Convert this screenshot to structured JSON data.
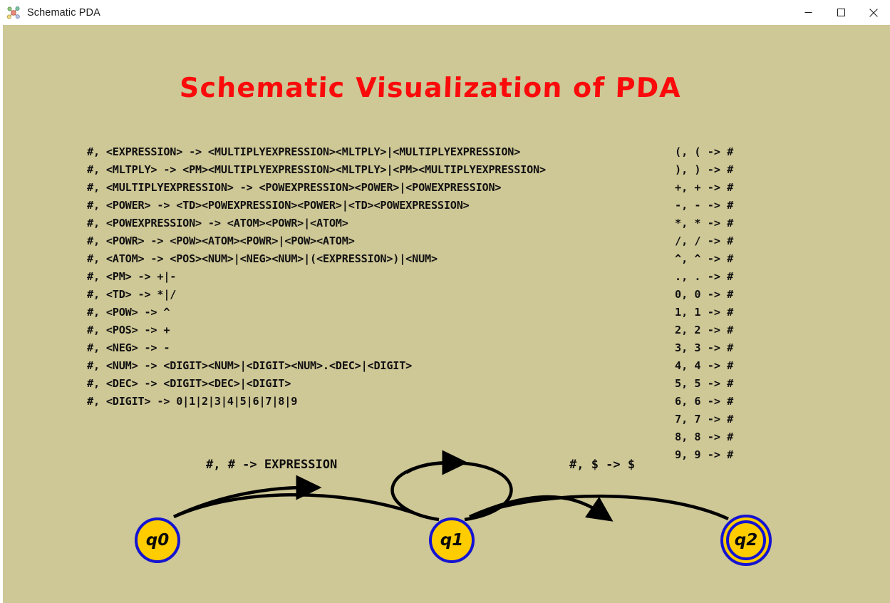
{
  "window": {
    "title": "Schematic PDA",
    "icon": "graph-nodes-icon",
    "minimize_label": "Minimize",
    "maximize_label": "Maximize",
    "close_label": "Close"
  },
  "colors": {
    "canvas_background": "#cec796",
    "title_text": "#fa0a0a",
    "state_fill": "#ffcc00",
    "state_stroke": "#1414d2",
    "edge_stroke": "#000000",
    "body_text": "#111111"
  },
  "page": {
    "title": "Schematic Visualization of PDA"
  },
  "grammar_rules": [
    "#, <EXPRESSION> -> <MULTIPLYEXPRESSION><MLTPLY>|<MULTIPLYEXPRESSION>",
    "#, <MLTPLY> -> <PM><MULTIPLYEXPRESSION><MLTPLY>|<PM><MULTIPLYEXPRESSION>",
    "#, <MULTIPLYEXPRESSION> -> <POWEXPRESSION><POWER>|<POWEXPRESSION>",
    "#, <POWER> -> <TD><POWEXPRESSION><POWER>|<TD><POWEXPRESSION>",
    "#, <POWEXPRESSION> -> <ATOM><POWR>|<ATOM>",
    "#, <POWR> -> <POW><ATOM><POWR>|<POW><ATOM>",
    "#, <ATOM> -> <POS><NUM>|<NEG><NUM>|(<EXPRESSION>)|<NUM>",
    "#, <PM> -> +|-",
    "#, <TD> -> *|/",
    "#, <POW> -> ^",
    "#, <POS> -> +",
    "#, <NEG> -> -",
    "#, <NUM> -> <DIGIT><NUM>|<DIGIT><NUM>.<DEC>|<DIGIT>",
    "#, <DEC> -> <DIGIT><DEC>|<DIGIT>",
    "#, <DIGIT> -> 0|1|2|3|4|5|6|7|8|9"
  ],
  "stack_rules": [
    "(, ( -> #",
    "), ) -> #",
    "+, + -> #",
    "-, - -> #",
    "*, * -> #",
    "/, / -> #",
    "^, ^ -> #",
    "., . -> #",
    "0, 0 -> #",
    "1, 1 -> #",
    "2, 2 -> #",
    "3, 3 -> #",
    "4, 4 -> #",
    "5, 5 -> #",
    "6, 6 -> #",
    "7, 7 -> #",
    "8, 8 -> #",
    "9, 9 -> #"
  ],
  "automaton": {
    "states": [
      {
        "id": "q0",
        "label": "q0",
        "accepting": false
      },
      {
        "id": "q1",
        "label": "q1",
        "accepting": false
      },
      {
        "id": "q2",
        "label": "q2",
        "accepting": true
      }
    ],
    "transitions": [
      {
        "from": "q0",
        "to": "q1",
        "label": "#, # -> EXPRESSION"
      },
      {
        "from": "q1",
        "to": "q1",
        "label": ""
      },
      {
        "from": "q1",
        "to": "q2",
        "label": "#, $ -> $"
      }
    ]
  }
}
